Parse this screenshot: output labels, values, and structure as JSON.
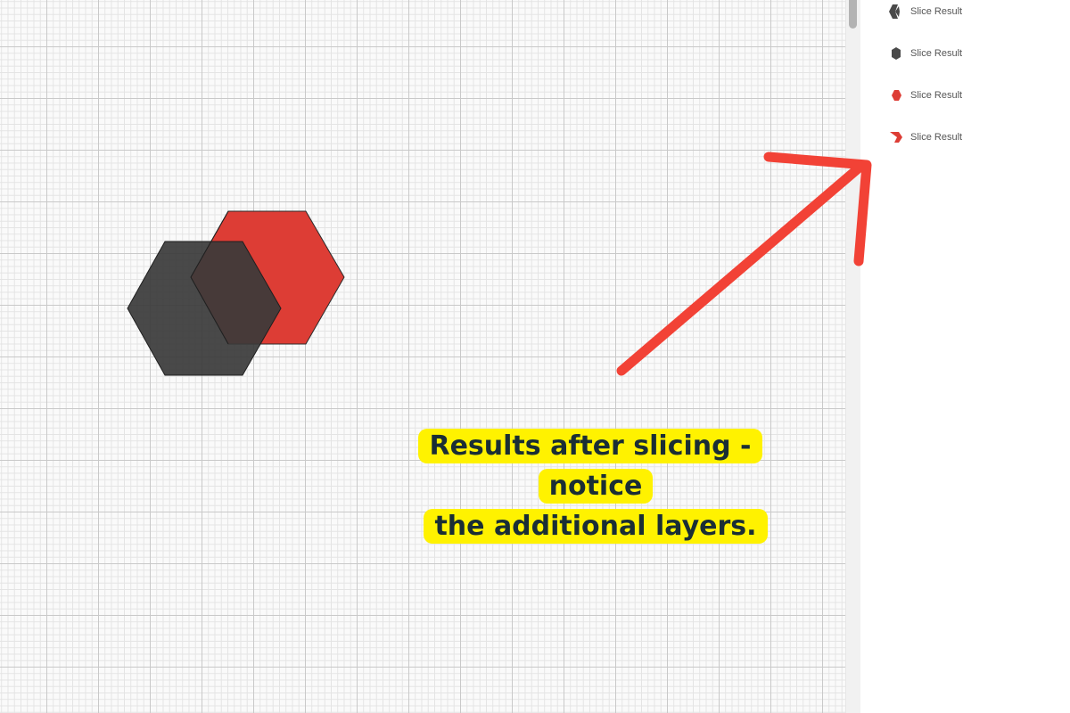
{
  "canvas": {
    "shapes": [
      {
        "name": "red-hexagon",
        "color": "#dd3d35"
      },
      {
        "name": "dark-hexagon",
        "color": "#3d3d3d"
      }
    ]
  },
  "layers_panel": {
    "items": [
      {
        "label": "Slice Result",
        "icon": "dark-chevron-slice-icon",
        "color": "#4a4a4a"
      },
      {
        "label": "Slice Result",
        "icon": "dark-hexagon-slice-icon",
        "color": "#4a4a4a"
      },
      {
        "label": "Slice Result",
        "icon": "red-hexagon-slice-icon",
        "color": "#dd3d35"
      },
      {
        "label": "Slice Result",
        "icon": "red-chevron-slice-icon",
        "color": "#dd3d35"
      }
    ]
  },
  "annotation": {
    "line1": "Results after slicing - notice",
    "line2": "the additional layers.",
    "highlight_color": "#fff200",
    "arrow_color": "#f24236"
  }
}
